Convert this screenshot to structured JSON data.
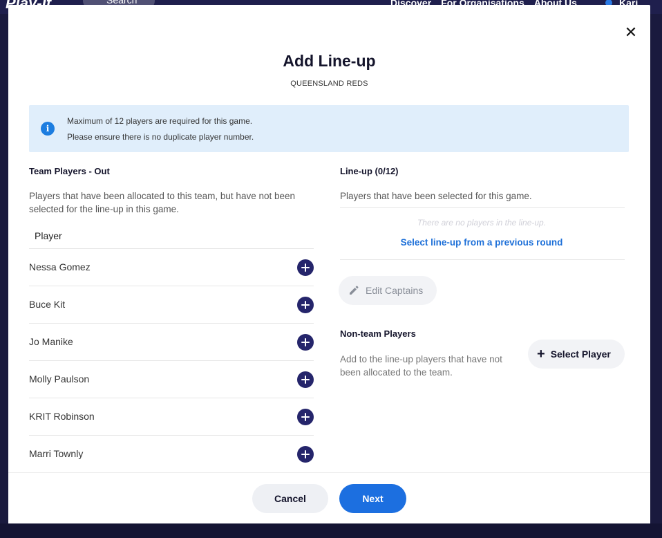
{
  "topnav": {
    "logo": "Play-It",
    "search_label": "Search",
    "links": [
      "Discover",
      "For Organisations",
      "About Us"
    ],
    "user_name": "Kari"
  },
  "modal": {
    "title": "Add Line-up",
    "subtitle": "QUEENSLAND REDS",
    "close_label": "✕",
    "info": {
      "line1": "Maximum of 12 players are required for this game.",
      "line2": "Please ensure there is no duplicate player number."
    },
    "left": {
      "heading": "Team Players - Out",
      "description": "Players that have been allocated to this team, but have not been selected for the line-up in this game.",
      "column_header": "Player",
      "players": [
        {
          "name": "Nessa Gomez"
        },
        {
          "name": "Buce Kit"
        },
        {
          "name": "Jo Manike"
        },
        {
          "name": "Molly Paulson"
        },
        {
          "name": "KRIT Robinson"
        },
        {
          "name": "Marri Townly"
        }
      ]
    },
    "right": {
      "lineup_heading": "Line-up (0/12)",
      "lineup_description": "Players that have been selected for this game.",
      "empty_message": "There are no players in the line-up.",
      "previous_round_link": "Select line-up from a previous round",
      "edit_captains_label": "Edit Captains",
      "non_team_heading": "Non-team Players",
      "non_team_description": "Add to the line-up players that have not been allocated to the team.",
      "select_player_label": "Select Player"
    },
    "footer": {
      "cancel_label": "Cancel",
      "next_label": "Next"
    }
  },
  "colors": {
    "primary_blue": "#1c6fe0",
    "navy": "#25256b",
    "info_bg": "#e0eefb",
    "backdrop": "#1a1a3e"
  }
}
